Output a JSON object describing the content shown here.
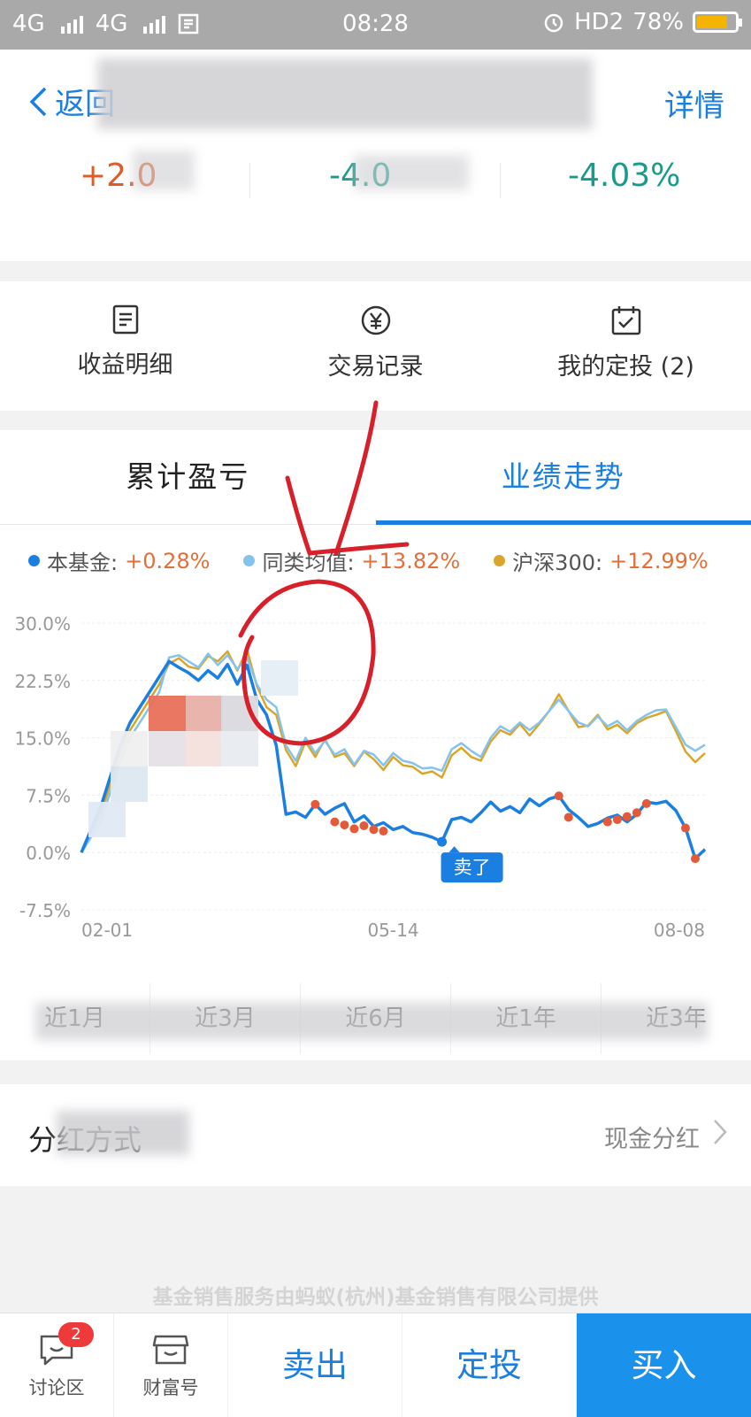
{
  "status_bar": {
    "network1": "4G",
    "network2": "4G",
    "time": "08:28",
    "hd": "HD2",
    "battery": "78%",
    "battery_level": 0.78
  },
  "header": {
    "back_label": "返回",
    "detail_label": "详情"
  },
  "summary": {
    "value_1": "+2.0",
    "value_2": "-4.0",
    "value_3": "-4.03%"
  },
  "quick_links": {
    "income_detail": "收益明细",
    "trade_records": "交易记录",
    "my_plans": "我的定投 (2)"
  },
  "tabs": {
    "cumulative": "累计盈亏",
    "performance": "业绩走势"
  },
  "legend": {
    "fund": {
      "name": "本基金:",
      "value": "+0.28%",
      "color": "#1a7fe0"
    },
    "peer": {
      "name": "同类均值:",
      "value": "+13.82%",
      "color": "#86c3ec"
    },
    "index": {
      "name": "沪深300:",
      "value": "+12.99%",
      "color": "#d9a62b"
    }
  },
  "chart_data": {
    "type": "line",
    "x_ticks": [
      "02-01",
      "05-14",
      "08-08"
    ],
    "y_ticks": [
      "30.0%",
      "22.5%",
      "15.0%",
      "7.5%",
      "0.0%",
      "-7.5%"
    ],
    "ylim": [
      -7.5,
      30
    ],
    "sell_marker": "卖了",
    "series": [
      {
        "name": "本基金",
        "color": "#1a7fe0",
        "values": [
          0,
          3,
          6,
          10,
          14,
          17,
          19,
          21,
          23,
          25,
          24.2,
          23.5,
          22.5,
          23.8,
          22.8,
          24.6,
          22.0,
          24.5,
          20.0,
          18.0,
          14.0,
          5.0,
          5.3,
          4.6,
          6.3,
          5.0,
          5.8,
          6.4,
          4.0,
          4.8,
          3.4,
          3.9,
          3.0,
          3.4,
          2.6,
          2.4,
          2.0,
          1.4,
          4.3,
          4.6,
          4.0,
          5.2,
          6.6,
          5.4,
          6.0,
          5.2,
          7.0,
          6.1,
          7.0,
          7.4,
          5.6,
          4.6,
          3.4,
          3.8,
          4.5,
          4.9,
          4.0,
          5.0,
          6.6,
          6.4,
          6.7,
          5.5,
          3.2,
          -0.8,
          0.4
        ]
      },
      {
        "name": "同类均值",
        "color": "#86c3ec",
        "values": [
          0,
          2,
          4,
          8,
          12,
          15,
          17,
          19,
          21,
          25.5,
          25.8,
          25.0,
          24.2,
          26.0,
          24.5,
          25.8,
          24.0,
          25.5,
          22.0,
          20.0,
          19.0,
          14.0,
          12.0,
          15.0,
          13.0,
          14.6,
          12.8,
          13.5,
          11.5,
          13.3,
          12.8,
          11.4,
          13.0,
          12.0,
          11.7,
          11.0,
          11.1,
          10.7,
          13.5,
          14.3,
          13.3,
          12.5,
          15.0,
          16.5,
          15.8,
          17.0,
          16.0,
          17.0,
          18.5,
          20.0,
          18.5,
          17.0,
          16.5,
          17.8,
          16.5,
          17.2,
          16.0,
          17.2,
          18.0,
          18.6,
          18.7,
          16.4,
          14.1,
          13.3,
          14.1
        ]
      },
      {
        "name": "沪深300",
        "color": "#d9a62b",
        "values": [
          0,
          2.5,
          5,
          9,
          13,
          16,
          18,
          20,
          22,
          24.7,
          25.4,
          24.3,
          24.0,
          25.7,
          25.0,
          26.3,
          23.8,
          26.5,
          21.8,
          19.0,
          18.0,
          13.4,
          11.3,
          14.5,
          12.5,
          14.8,
          12.5,
          13.0,
          11.3,
          13.2,
          12.2,
          10.8,
          12.5,
          11.4,
          11.2,
          10.3,
          10.6,
          9.8,
          12.7,
          13.7,
          12.5,
          12.0,
          14.5,
          16.0,
          15.4,
          16.8,
          15.3,
          16.8,
          18.5,
          20.7,
          18.5,
          16.4,
          16.6,
          18.0,
          16.1,
          16.7,
          15.6,
          16.9,
          17.6,
          18.0,
          18.5,
          15.9,
          13.2,
          11.8,
          13.0
        ]
      }
    ],
    "sell_points": [
      [
        24,
        6.3
      ],
      [
        26,
        4.0
      ],
      [
        27,
        3.6
      ],
      [
        28,
        3.1
      ],
      [
        29,
        3.5
      ],
      [
        30,
        3.0
      ],
      [
        31,
        2.8
      ],
      [
        49,
        7.4
      ],
      [
        50,
        4.6
      ],
      [
        54,
        4.0
      ],
      [
        55,
        4.3
      ],
      [
        56,
        4.7
      ],
      [
        57,
        5.2
      ],
      [
        58,
        6.4
      ],
      [
        62,
        3.2
      ],
      [
        63,
        -0.8
      ]
    ],
    "buy_point": [
      37,
      1.4
    ]
  },
  "periods": [
    "近1月",
    "近3月",
    "近6月",
    "近1年",
    "近3年"
  ],
  "dividend": {
    "label": "分红方式",
    "value": "现金分红"
  },
  "footer_note": "基金销售服务由蚂蚁(杭州)基金销售有限公司提供",
  "bottom_bar": {
    "discuss": "讨论区",
    "discuss_badge": "2",
    "wealth": "财富号",
    "sell": "卖出",
    "plan": "定投",
    "buy": "买入"
  }
}
